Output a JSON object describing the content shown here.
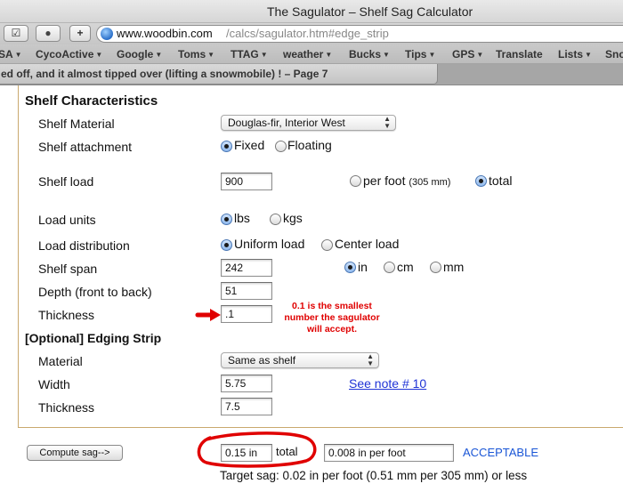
{
  "window": {
    "title": "The Sagulator – Shelf Sag Calculator"
  },
  "toolbar": {
    "extension_glyph": "☑",
    "stop_glyph": "●",
    "add_glyph": "+",
    "url_host": "www.woodbin.com",
    "url_path": "/calcs/sagulator.htm#edge_strip"
  },
  "bookmarks": [
    {
      "label": "SA"
    },
    {
      "label": "CycoActive"
    },
    {
      "label": "Google"
    },
    {
      "label": "Toms"
    },
    {
      "label": "TTAG"
    },
    {
      "label": "weather"
    },
    {
      "label": "Bucks"
    },
    {
      "label": "Tips"
    },
    {
      "label": "GPS"
    },
    {
      "label": "Translate"
    },
    {
      "label": "Lists"
    },
    {
      "label": "Sno"
    }
  ],
  "tab": {
    "label": "ed off, and it almost tipped over (lifting a snowmobile) ! – Page 7"
  },
  "shelf": {
    "heading": "Shelf Characteristics",
    "material_label": "Shelf Material",
    "material_value": "Douglas-fir, Interior West",
    "attachment_label": "Shelf attachment",
    "attachment_options": [
      "Fixed",
      "Floating"
    ],
    "attachment_selected": "Fixed",
    "load_label": "Shelf load",
    "load_value": "900",
    "load_per_foot": "per foot",
    "load_per_foot_note": "(305 mm)",
    "load_total": "total",
    "load_mode_selected": "total",
    "units_label": "Load units",
    "units_options": [
      "lbs",
      "kgs"
    ],
    "units_selected": "lbs",
    "distribution_label": "Load distribution",
    "distribution_options": [
      "Uniform load",
      "Center load"
    ],
    "distribution_selected": "Uniform load",
    "span_label": "Shelf span",
    "span_value": "242",
    "span_units": [
      "in",
      "cm",
      "mm"
    ],
    "span_unit_selected": "in",
    "depth_label": "Depth (front to back)",
    "depth_value": "51",
    "thickness_label": "Thickness",
    "thickness_value": ".1"
  },
  "edging": {
    "heading": "[Optional]  Edging Strip",
    "material_label": "Material",
    "material_value": "Same as shelf",
    "width_label": "Width",
    "width_value": "5.75",
    "note_link": "See note # 10",
    "thickness_label": "Thickness",
    "thickness_value": "7.5"
  },
  "results": {
    "compute_label": "Compute sag-->",
    "sag_value": "0.15 in",
    "sag_total_label": "total",
    "per_foot_value": "0.008 in per foot",
    "status": "ACCEPTABLE",
    "target": "Target sag: 0.02 in per foot (0.51 mm per 305 mm) or less"
  },
  "annotation": {
    "lines": [
      "0.1 is the smallest",
      "number the sagulator",
      "will accept."
    ],
    "color": "#e00000"
  },
  "colors": {
    "link": "#1f33d6",
    "status": "#1a56d6",
    "frame": "#c9a96e"
  }
}
